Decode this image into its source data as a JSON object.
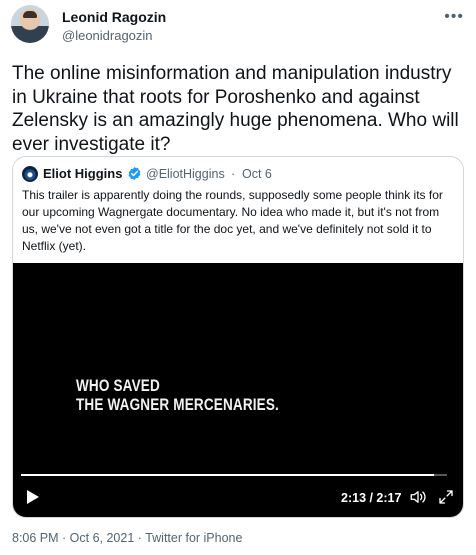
{
  "tweet": {
    "author_name": "Leonid Ragozin",
    "author_handle": "@leonidragozin",
    "more_icon": "more-horizontal-icon",
    "text": "The online misinformation and manipulation industry in Ukraine that roots for Poroshenko and against Zelensky is an amazingly huge phenomena. Who will ever investigate it?",
    "timestamp": "8:06 PM · Oct 6, 2021",
    "separator": " · ",
    "source": "Twitter for iPhone"
  },
  "quoted": {
    "author_name": "Eliot Higgins",
    "verified_icon": "verified-badge-icon",
    "author_handle": "@EliotHiggins",
    "separator": "·",
    "date": "Oct 6",
    "text": "This trailer is apparently doing the rounds, supposedly some people think its for our upcoming Wagnergate documentary. No idea who made it, but it's not from us, we've not even got a title for the doc yet, and we've definitely not sold it to Netflix (yet).",
    "video": {
      "caption_line1": "WHO SAVED",
      "caption_line2": "THE WAGNER MERCENARIES.",
      "time": "2:13 / 2:17",
      "progress": 0.97,
      "play_icon": "play-icon",
      "volume_icon": "volume-icon",
      "fullscreen_icon": "fullscreen-icon"
    }
  },
  "colors": {
    "text_primary": "#0f1419",
    "text_secondary": "#536471",
    "border": "#cfd9de",
    "verified": "#1d9bf0",
    "video_bg": "#000000"
  }
}
